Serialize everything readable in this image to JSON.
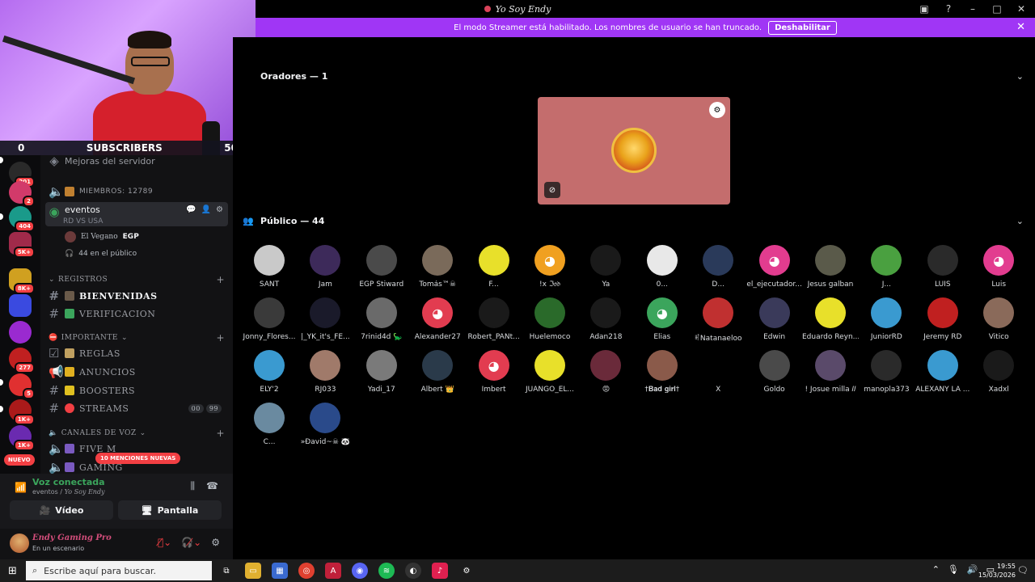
{
  "window": {
    "title": "Yo Soy Endy"
  },
  "banner": {
    "message": "El modo Streamer está habilitado. Los nombres de usuario se han truncado.",
    "button": "Deshabilitar"
  },
  "webcam": {
    "left_count": "0",
    "label": "SUBSCRIBERS",
    "right_count": "50"
  },
  "rail": {
    "badges": [
      "201",
      "2",
      "404",
      "5K+",
      "8K+",
      "277",
      "5",
      "1K+",
      "1K+"
    ],
    "new_label": "NUEVO"
  },
  "sidebar": {
    "server_boost": "Mejoras del servidor",
    "members_channel": "MIEMBROS: 12789",
    "active_channel": {
      "name": "eventos",
      "sub": "RD VS USA"
    },
    "speaker_member": {
      "name": "El Vegano",
      "tag": "EGP"
    },
    "audience_count": "44 en el público",
    "cat_registros": "REGISTROS",
    "channels_registros": [
      "BIENVENIDAS",
      "VERIFICACION"
    ],
    "cat_importante": "IMPORTANTE",
    "channels_importante": [
      "REGLAS",
      "ANUNCIOS",
      "BOOSTERS",
      "STREAMS"
    ],
    "streams_counts": [
      "00",
      "99"
    ],
    "cat_voz": "CANALES DE VOZ",
    "channels_voz": [
      "FIVE M",
      "GAMING"
    ],
    "mentions": "10 MENCIONES NUEVAS"
  },
  "voice": {
    "status": "Voz conectada",
    "location_prefix": "eventos / ",
    "location_server": "Yo Soy Endy",
    "video_label": "Vídeo",
    "screen_label": "Pantalla"
  },
  "user": {
    "name": "Endy Gaming Pro",
    "status": "En un escenario"
  },
  "stage": {
    "speakers_title": "Oradores — 1",
    "audience_title": "Público — 44",
    "audience": [
      {
        "name": "SANT",
        "color": "#c9c9c9"
      },
      {
        "name": "Jam",
        "color": "#3d2a5a"
      },
      {
        "name": "EGP Stiward",
        "color": "#4a4a4a"
      },
      {
        "name": "Tomás™☠",
        "color": "#7a6a5a"
      },
      {
        "name": "F...",
        "color": "#e8e02a"
      },
      {
        "name": "!x ℑ𝔬𝔡",
        "color": "#f0a020",
        "discord": true
      },
      {
        "name": "Ya",
        "color": "#1a1a1a"
      },
      {
        "name": "0...",
        "color": "#e8e8e8"
      },
      {
        "name": "D...",
        "color": "#2a3a5a"
      },
      {
        "name": "el_ejecutador...",
        "color": "#e23c8f",
        "discord": true
      },
      {
        "name": "Jesus galban",
        "color": "#5a5a4a"
      },
      {
        "name": "J...",
        "color": "#4aa040"
      },
      {
        "name": "LUIS",
        "color": "#2a2a2a"
      },
      {
        "name": "Luis",
        "color": "#e23c8f",
        "discord": true
      },
      {
        "name": "Jonny_Flores...",
        "color": "#3a3a3a"
      },
      {
        "name": "|_YK_it's_FE...",
        "color": "#1a1a2a"
      },
      {
        "name": "7rinid4d 🦕",
        "color": "#6a6a6a"
      },
      {
        "name": "Alexander27",
        "color": "#e23c50",
        "discord": true
      },
      {
        "name": "Robert_PANt...",
        "color": "#1a1a1a"
      },
      {
        "name": "Huelemoco",
        "color": "#2a6a2a"
      },
      {
        "name": "Adan218",
        "color": "#1a1a1a"
      },
      {
        "name": "Elias",
        "color": "#3ba55c",
        "discord": true
      },
      {
        "name": "ꎭNatanaeloo",
        "color": "#c03030"
      },
      {
        "name": "Edwin",
        "color": "#3a3a5a"
      },
      {
        "name": "Eduardo Reyn...",
        "color": "#e8e02a"
      },
      {
        "name": "JuniorRD",
        "color": "#3a9ad0"
      },
      {
        "name": "Jeremy RD",
        "color": "#c02020"
      },
      {
        "name": "Vitico",
        "color": "#8a6a5a"
      },
      {
        "name": "ELY'2",
        "color": "#3a9ad0"
      },
      {
        "name": "RJ033",
        "color": "#a07a6a"
      },
      {
        "name": "Yadi_17",
        "color": "#7a7a7a"
      },
      {
        "name": "Albert 👑",
        "color": "#2a3a4a"
      },
      {
        "name": "Imbert",
        "color": "#e23c50",
        "discord": true
      },
      {
        "name": "JUANGO_EL...",
        "color": "#e8e02a"
      },
      {
        "name": "😡",
        "color": "#6a2a3a"
      },
      {
        "name": "†𝐁𝐚𝐝 𝐠𝐢𝐫𝐥†",
        "color": "#8a5a4a"
      },
      {
        "name": "X",
        "color": "#000000"
      },
      {
        "name": "Goldo",
        "color": "#4a4a4a"
      },
      {
        "name": "! Josue milla 𝐼𝐼",
        "color": "#5a4a6a"
      },
      {
        "name": "manopla373",
        "color": "#2a2a2a"
      },
      {
        "name": "ALEXANY LA ...",
        "color": "#3a9ad0"
      },
      {
        "name": "Xadxl",
        "color": "#1a1a1a"
      },
      {
        "name": "C...",
        "color": "#6a8aa0"
      },
      {
        "name": "»Đavid~☠ 🐼",
        "color": "#2a4a8a"
      }
    ]
  },
  "taskbar": {
    "search_placeholder": "Escribe aquí para buscar.",
    "time": "19:55",
    "date": "15/03/2026"
  }
}
